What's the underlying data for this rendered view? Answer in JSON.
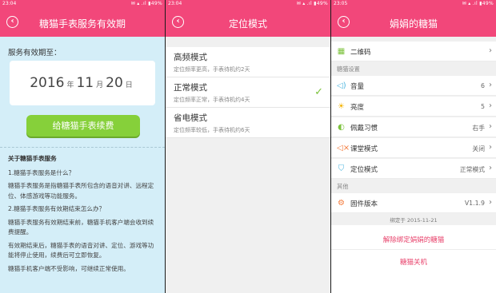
{
  "status": {
    "p1": {
      "time": "23:04",
      "right": "✉ ▴ .ıl ▮49%"
    },
    "p2": {
      "time": "23:04",
      "right": "✉ ▴ .ıl ▮49%"
    },
    "p3": {
      "time": "23:05",
      "right": "✉ ▴ .ıl ▮49%"
    }
  },
  "panel1": {
    "title": "糖猫手表服务有效期",
    "expiry_label": "服务有效期至：",
    "year": "2016",
    "year_unit": "年",
    "month": "11",
    "month_unit": "月",
    "day": "20",
    "day_unit": "日",
    "renew_button": "给糖猫手表续费",
    "faq_title": "关于糖猫手表服务",
    "faq": [
      "1.糖猫手表服务是什么？",
      "糖猫手表服务是指糖猫手表所包含的语音对讲、远程定位、体感游戏等功能服务。",
      "2.糖猫手表服务有效期结束怎么办？",
      "糖猫手表服务有效期结束前，糖猫手机客户端会收到续费提醒。",
      "有效期结束后，糖猫手表的语音对讲、定位、游戏等功能将停止使用，续费后可立即恢复。",
      "糖猫手机客户端不受影响，可继续正常使用。"
    ]
  },
  "panel2": {
    "title": "定位模式",
    "modes": [
      {
        "title": "高频模式",
        "desc": "定位频率更高，手表待机约2天"
      },
      {
        "title": "正常模式",
        "desc": "定位频率正常，手表待机约4天"
      },
      {
        "title": "省电模式",
        "desc": "定位频率较低，手表待机约6天"
      }
    ],
    "selected_check": "✓"
  },
  "panel3": {
    "title": "娟娟的糖猫",
    "qr_label": "二维码",
    "section_settings": "糖猫设置",
    "settings": [
      {
        "label": "音量",
        "value": "6",
        "icon": "volume-icon"
      },
      {
        "label": "亮度",
        "value": "5",
        "icon": "brightness-icon"
      },
      {
        "label": "佩戴习惯",
        "value": "右手",
        "icon": "wearing-habit-icon"
      },
      {
        "label": "课堂模式",
        "value": "关闭",
        "icon": "class-mode-icon"
      },
      {
        "label": "定位模式",
        "value": "正常模式",
        "icon": "location-mode-icon"
      }
    ],
    "section_other": "其他",
    "firmware_label": "固件版本",
    "firmware_value": "V1.1.9",
    "bound_text": "绑定于 2015-11-21",
    "unbind_label": "解除绑定娟娟的糖猫",
    "shutdown_label": "糖猫关机"
  },
  "colors": {
    "brand": "#f2477a",
    "accent_green": "#86d03a",
    "panel1_bg": "#d4eef8"
  }
}
